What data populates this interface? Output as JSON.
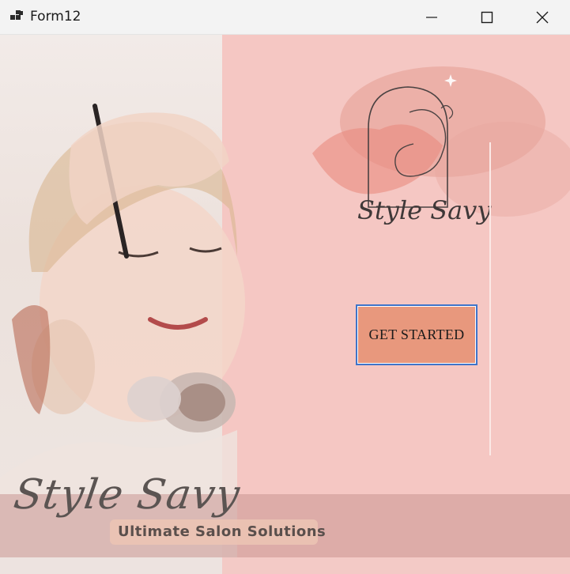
{
  "window": {
    "title": "Form12",
    "minimize_symbol": "—",
    "maximize_symbol": "☐",
    "close_symbol": "✕"
  },
  "logo": {
    "brand_text": "Style Savy",
    "icon": "woman-face-arch-logo"
  },
  "actions": {
    "get_started_label": "GET STARTED"
  },
  "banner": {
    "brand_text": "Style Savy",
    "tagline": "Ultimate Salon Solutions"
  },
  "colors": {
    "button_fill": "#e8987d",
    "button_border": "#3f74c9",
    "right_panel": "#f5c7c3",
    "left_panel": "#efe7e4",
    "script_text": "#5b5452"
  }
}
